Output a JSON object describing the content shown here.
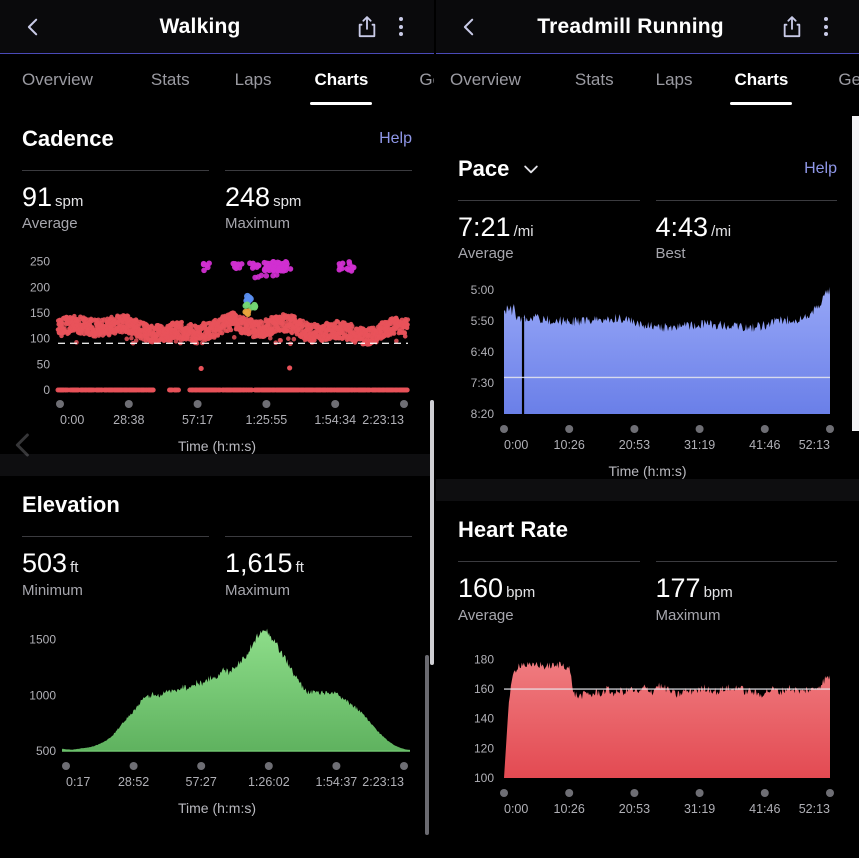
{
  "left_pane": {
    "appbar": {
      "title": "Walking",
      "back_icon": "chevron-left-icon",
      "share_icon": "share-icon",
      "menu_icon": "more-vertical-icon"
    },
    "tabs": [
      {
        "label": "Overview",
        "active": false
      },
      {
        "label": "Stats",
        "active": false
      },
      {
        "label": "Laps",
        "active": false
      },
      {
        "label": "Charts",
        "active": true
      },
      {
        "label": "Gear",
        "active": false
      }
    ],
    "cadence_card": {
      "title": "Cadence",
      "help": "Help",
      "avg_value": "91",
      "avg_unit": "spm",
      "avg_label": "Average",
      "max_value": "248",
      "max_unit": "spm",
      "max_label": "Maximum",
      "x_caption": "Time (h:m:s)"
    },
    "elevation_card": {
      "title": "Elevation",
      "min_value": "503",
      "min_unit": "ft",
      "min_label": "Minimum",
      "max_value": "1,615",
      "max_unit": "ft",
      "max_label": "Maximum",
      "x_caption": "Time (h:m:s)"
    }
  },
  "right_pane": {
    "appbar": {
      "title": "Treadmill Running",
      "back_icon": "chevron-left-icon",
      "share_icon": "share-icon",
      "menu_icon": "more-vertical-icon"
    },
    "tabs": [
      {
        "label": "Overview",
        "active": false
      },
      {
        "label": "Stats",
        "active": false
      },
      {
        "label": "Laps",
        "active": false
      },
      {
        "label": "Charts",
        "active": true
      },
      {
        "label": "Gear",
        "active": false
      }
    ],
    "pace_card": {
      "title": "Pace",
      "dropdown_icon": "chevron-down-icon",
      "help": "Help",
      "avg_value": "7:21",
      "avg_unit": "/mi",
      "avg_label": "Average",
      "best_value": "4:43",
      "best_unit": "/mi",
      "best_label": "Best",
      "x_caption": "Time (h:m:s)"
    },
    "hr_card": {
      "title": "Heart Rate",
      "avg_value": "160",
      "avg_unit": "bpm",
      "avg_label": "Average",
      "max_value": "177",
      "max_unit": "bpm",
      "max_label": "Maximum",
      "x_caption": "Time (h:m:s)"
    }
  },
  "colors": {
    "accent_underline": "#4a4ab8",
    "help_link": "#8f97e8",
    "cadence_red": "#e8525a",
    "cadence_magenta": "#d12fd1",
    "cadence_blue": "#5b8ff0",
    "cadence_green": "#74d674",
    "cadence_orange": "#e8a33d",
    "elevation_green": "#6fc46f",
    "pace_blue": "#7b8ff0",
    "hr_red": "#e8555c",
    "background": "#000000"
  },
  "chart_data": [
    {
      "id": "cadence",
      "type": "scatter",
      "title": "Cadence",
      "xlabel": "Time (h:m:s)",
      "ylabel": "spm",
      "ylim": [
        0,
        265
      ],
      "yticks": [
        "0",
        "50",
        "100",
        "150",
        "200",
        "250"
      ],
      "ytick_values": [
        0,
        50,
        100,
        150,
        200,
        250
      ],
      "xticks": [
        "0:00",
        "28:38",
        "57:17",
        "1:25:55",
        "1:54:34",
        "2:23:13"
      ],
      "average_line": 91,
      "grid": false,
      "series": [
        {
          "name": "walking-cadence",
          "color": "#e8525a",
          "approx_range": [
            95,
            150
          ],
          "note": "dense band of red points ~100-140 spm across entire duration"
        },
        {
          "name": "zero-cadence",
          "color": "#e8525a",
          "approx_range": [
            0,
            0
          ],
          "note": "row of red points at 0 spm (stopped/idle samples)"
        },
        {
          "name": "running-cadence",
          "color": "#d12fd1",
          "approx_range": [
            225,
            250
          ],
          "note": "magenta cluster ~235-250 spm between 1:00:00 and 2:10:00"
        },
        {
          "name": "burst-blue",
          "color": "#5b8ff0",
          "approx_range": [
            170,
            185
          ],
          "note": "small blue cluster near 1:20:00"
        },
        {
          "name": "burst-green",
          "color": "#74d674",
          "approx_range": [
            160,
            170
          ],
          "note": "small green cluster near 1:20:00"
        },
        {
          "name": "burst-orange",
          "color": "#e8a33d",
          "approx_range": [
            145,
            155
          ],
          "note": "small orange cluster near 1:20:00"
        }
      ]
    },
    {
      "id": "elevation",
      "type": "area",
      "title": "Elevation",
      "xlabel": "Time (h:m:s)",
      "ylabel": "ft",
      "ylim": [
        500,
        1650
      ],
      "yticks": [
        "500",
        "1000",
        "1500"
      ],
      "ytick_values": [
        500,
        1000,
        1500
      ],
      "xticks": [
        "0:17",
        "28:52",
        "57:27",
        "1:26:02",
        "1:54:37",
        "2:23:13"
      ],
      "minimum": 503,
      "maximum": 1615,
      "color": "#6fc46f",
      "grid": false,
      "values": [
        520,
        515,
        512,
        518,
        525,
        530,
        540,
        555,
        575,
        600,
        640,
        690,
        745,
        800,
        850,
        905,
        960,
        985,
        1010,
        995,
        1020,
        1045,
        1030,
        1060,
        1080,
        1065,
        1090,
        1120,
        1105,
        1140,
        1180,
        1165,
        1230,
        1210,
        1250,
        1290,
        1330,
        1400,
        1460,
        1560,
        1610,
        1555,
        1500,
        1420,
        1350,
        1270,
        1190,
        1120,
        1065,
        1020,
        1040,
        1010,
        1030,
        1005,
        1020,
        990,
        960,
        930,
        900,
        860,
        810,
        760,
        710,
        660,
        615,
        580,
        550,
        530,
        515,
        510
      ]
    },
    {
      "id": "pace",
      "type": "area",
      "title": "Pace",
      "xlabel": "Time (h:m:s)",
      "ylabel": "/mi",
      "yticks": [
        "5:00",
        "5:50",
        "6:40",
        "7:30",
        "8:20"
      ],
      "ytick_values": [
        "5:00",
        "5:50",
        "6:40",
        "7:30",
        "8:20"
      ],
      "y_inverted": true,
      "ylim": [
        "8:20",
        "5:00"
      ],
      "xticks": [
        "0:00",
        "10:26",
        "20:53",
        "31:19",
        "41:46",
        "52:13"
      ],
      "average": "7:21",
      "best": "4:43",
      "average_line_label": "7:21",
      "color": "#7b8ff0",
      "grid": false,
      "note": "filled area; pace mostly between 5:50 and 6:20 /mi, final sprint reaches about 4:50 /mi; one dropout spike to 8:20 near 5:00"
    },
    {
      "id": "heart_rate",
      "type": "area",
      "title": "Heart Rate",
      "xlabel": "Time (h:m:s)",
      "ylabel": "bpm",
      "ylim": [
        100,
        185
      ],
      "yticks": [
        "100",
        "120",
        "140",
        "160",
        "180"
      ],
      "ytick_values": [
        100,
        120,
        140,
        160,
        180
      ],
      "xticks": [
        "0:00",
        "10:26",
        "20:53",
        "31:19",
        "41:46",
        "52:13"
      ],
      "average": 160,
      "maximum": 177,
      "average_line": 160,
      "color": "#e8555c",
      "grid": false,
      "values": [
        100,
        150,
        170,
        176,
        177,
        176,
        175,
        177,
        176,
        175,
        176,
        175,
        177,
        176,
        174,
        157,
        155,
        156,
        157,
        156,
        158,
        157,
        160,
        158,
        157,
        159,
        158,
        160,
        159,
        157,
        161,
        160,
        158,
        163,
        161,
        160,
        158,
        156,
        157,
        159,
        158,
        160,
        159,
        161,
        160,
        159,
        158,
        160,
        161,
        159,
        162,
        160,
        158,
        159,
        157,
        156,
        158,
        159,
        160,
        158,
        159,
        161,
        160,
        159,
        158,
        160,
        159,
        161,
        163,
        167,
        168
      ]
    }
  ]
}
